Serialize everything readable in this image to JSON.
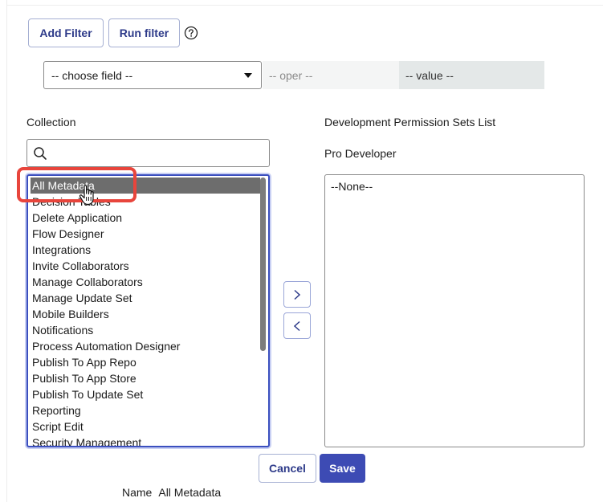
{
  "filter": {
    "add_filter_label": "Add Filter",
    "run_filter_label": "Run filter",
    "field_select_value": "-- choose field --",
    "oper_value": "-- oper --",
    "value_value": "-- value --"
  },
  "collection": {
    "title": "Collection",
    "search_value": "",
    "items": [
      "All Metadata",
      "Decision Tables",
      "Delete Application",
      "Flow Designer",
      "Integrations",
      "Invite Collaborators",
      "Manage Collaborators",
      "Manage Update Set",
      "Mobile Builders",
      "Notifications",
      "Process Automation Designer",
      "Publish To App Repo",
      "Publish To App Store",
      "Publish To Update Set",
      "Reporting",
      "Script Edit",
      "Security Management"
    ],
    "selected_item": "All Metadata"
  },
  "permission_list": {
    "title": "Development Permission Sets List",
    "subtitle": "Pro Developer",
    "items": [
      "--None--"
    ]
  },
  "actions": {
    "cancel_label": "Cancel",
    "save_label": "Save"
  },
  "footer": {
    "name_label": "Name",
    "name_value": "All Metadata"
  },
  "colors": {
    "accent": "#3d4bb4",
    "highlight": "#e8453c",
    "selected_row": "#6d6d6d"
  }
}
